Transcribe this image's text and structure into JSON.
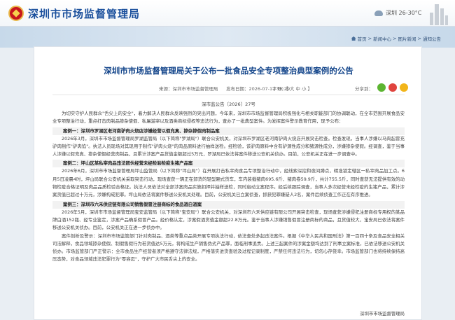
{
  "header": {
    "site_title": "深圳市市场监督管理局",
    "weather": "深圳 26-30°C"
  },
  "breadcrumb": {
    "items": [
      "首页",
      "新闻中心",
      "图片新闻",
      "通知公告"
    ],
    "sep": ">"
  },
  "article": {
    "title": "深圳市市场监督管理局关于公布一批食品安全专项整治典型案例的公告",
    "source_label": "来源：深圳市市场监督管理局",
    "date_label": "发布日期：2026-07-17 16:29",
    "size_label": "字号：【 大  中  小 】",
    "share_label": "分享到：",
    "doc_no": "深市监公告〔2026〕27号",
    "paragraphs": [
      {
        "type": "text",
        "text": "为切实守护人民群众\"舌尖上的安全\"，着力解决人民群众反映强烈的突出问题，今年来，深圳市市场监督管理局积极强化与相关职能部门的协调联动，在全市范围开展食品安全专项整治行动，重点打击肉制品掺杂使假、私屠滥宰以及酒类商标侵权等违法行为，查办了一批典型案件。为发挥案件警示教育作用，现予公布："
      },
      {
        "type": "case",
        "text": "案例一：深圳市罗湖区老河南驴肉火烧店涉嫌经营以假充真、掺杂掺假肉制品案"
      },
      {
        "type": "text",
        "text": "2026年3月，深圳市市场监督管理局罗湖监管局（以下简称\"罗湖局\"）联合公安机关，对深圳市罗湖区老河南驴肉火烧店开展突击检查。检查发现，当事人涉嫌以马肉起冒充驴肉制作\"驴肉馅\"。执法人员现场对其现用于制作\"驴肉火烧\"的肉品原料进行抽样送检。经检验，该驴肉原料中含有驴源性成分和猪源性成分，涉嫌掺杂使假。经调查，鉴于当事人涉嫌以假充真、掺杂使假经营肉制品，且累计涉案产品货值金额超过5万元，罗湖局已依法将案件移送公安机关侦办。目前，公安机关正在进一步调查中。"
      },
      {
        "type": "case",
        "text": "案例二：坪山区某私宰肉品违法团伙经营未经检验检疫生猪产品案"
      },
      {
        "type": "text",
        "text": "2026年6月，深圳市市场监督管理局坪山监管局（以下简称\"坪山局\"）在开展打击私宰肉食品专项整治行动中，经线索深挖和夜间蹲点，精准锁定辖区一私宰肉品加工点。6月5日凌晨4时，坪山局联合公安机关采取突击行动，现场查获一辆正在卸货的轻型厢式货车，车内装载猪肉695.6斤、猪肉卷59.9斤，共计755.5斤，同时查获无法提供有效的动物检疫合格证明及肉品品质检验合格证。执法人员依法对全部涉案肉品实施扣押并抽样送检，同时启动立案程序。经后续跟踪调查，当事人多次经营未经检疫的生猪产品，累计涉案货值已超过十万元，涉嫌构成犯罪。坪山局依法将案件移送公安机关处理。目前，公安机关已立案侦查，抓获犯罪嫌疑人2名，案件后续侦查工作正在有序推进。"
      },
      {
        "type": "case",
        "text": "案例三：深圳市六禾供应链有限公司销售假冒注册商标的食品酒白酒案"
      },
      {
        "type": "text",
        "text": "2026年5月，深圳市市场监督管理局宝安监管局（以下简称\"宝安局\"）联合公安机关，对深圳市六禾供应链有限公司开展突击检查，现场查获涉嫌侵犯注册商标专用权的某品牌白酒152瓶、经专业鉴定，涉案产品确系假冒产品。经价格认定，涉案假酒货值金额超22.8万元。鉴于当事人涉嫌销售假冒注册商标的商品，且货值较大，宝安局已依法将案件移送公安机关侦办。目前，公安机关正在进一步侦办中。"
      },
      {
        "type": "text",
        "text": "案件剖析及警示：深圳市市场监管部门针对肉制品、酒类等重点品类开展专项执法行动，依法查处多起违法案件。根据《中华人民共和国刑法》第一百四十条及食品安全相关司法解释，食品领域掺杂使假、制假售假行为若货值达5万元，将构成生产销售伪劣产品罪，面临刑事追责。上述三起案件的涉案金额均达到了刑事立案标准，已依法移送公安机关侦办。市场监管部门严正警示：全市食品生产经营者须严格遵守法律法规，严格落实进货查验及过程记录制度，严禁任何违法行为，切勿心存侥幸。市场监管部门也将持续保持高压态势，对食品领域违法犯罪行为\"零容忍\"，守护广大市民舌尖上的安全。"
      }
    ],
    "signoff": "深圳市市场监督管理局"
  },
  "colors": {
    "brand_blue": "#12448a",
    "emblem_red": "#c8161d"
  },
  "icons": [
    "emblem-icon",
    "weather-cloud-icon",
    "home-icon",
    "share-wechat-icon",
    "share-weibo-icon",
    "share-qzone-icon"
  ]
}
